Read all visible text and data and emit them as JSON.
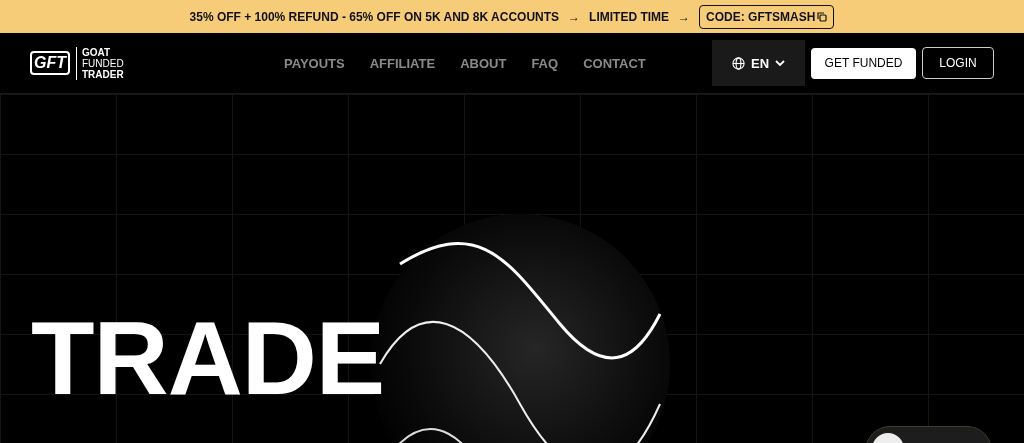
{
  "promo_bar": {
    "text": "35% OFF + 100% REFUND - 65% OFF ON 5K AND 8K ACCOUNTS",
    "arrow_1": "→",
    "limited": "LIMITED TIME",
    "arrow_2": "→",
    "code": "CODE: GFTSMASH"
  },
  "nav": {
    "logo_mark": "GFT",
    "logo_lines": [
      "GOAT",
      "FUNDED",
      "TRADER"
    ],
    "links": [
      {
        "label": "PAYOUTS"
      },
      {
        "label": "AFFILIATE"
      },
      {
        "label": "ABOUT"
      },
      {
        "label": "FAQ"
      },
      {
        "label": "CONTACT"
      }
    ],
    "language": "EN",
    "get_funded": "GET FUNDED",
    "login": "LOGIN"
  },
  "hero": {
    "title_lines": [
      "TRADE"
    ]
  }
}
